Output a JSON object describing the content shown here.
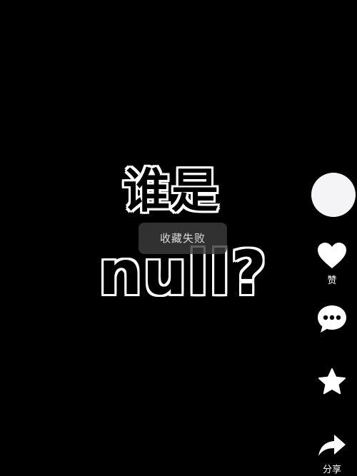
{
  "video": {
    "caption_line1": "谁是",
    "caption_line2": "null?"
  },
  "toast": {
    "message": "收藏失败"
  },
  "actions": {
    "like_label": "赞",
    "share_label": "分享"
  },
  "icons": {
    "like": "heart-icon",
    "comment": "comment-icon",
    "favorite": "star-icon",
    "share": "share-arrow-icon"
  },
  "colors": {
    "background": "#000000",
    "icon": "#ffffff",
    "toast_bg": "#3c3c3c",
    "avatar": "#f4f4f6"
  }
}
